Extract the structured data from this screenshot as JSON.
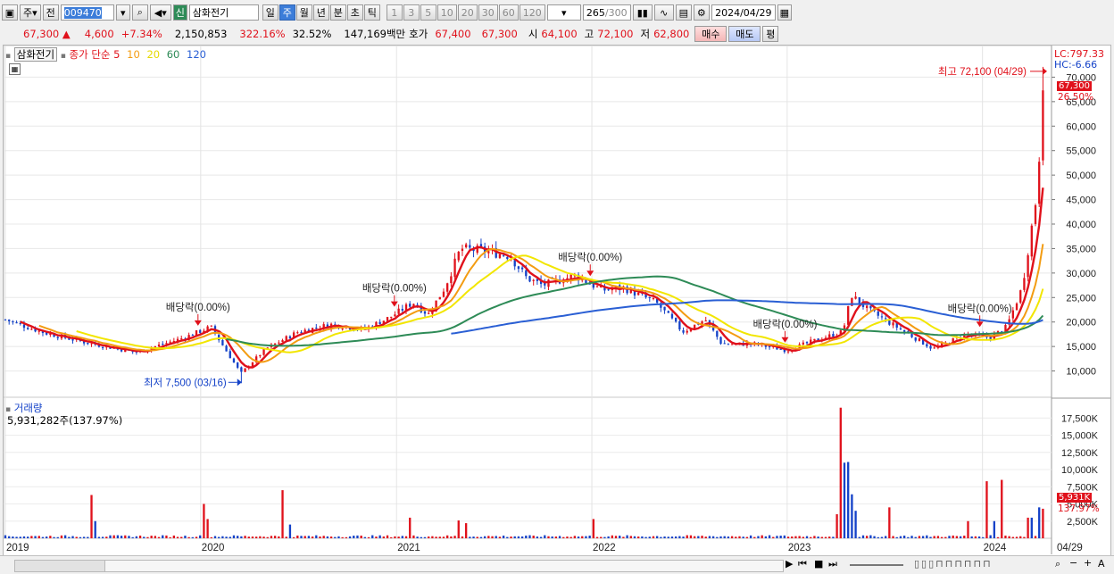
{
  "toolbar": {
    "period_type": "주",
    "prev_label": "전",
    "code": "009470",
    "credit_badge": "신",
    "stock_name": "삼화전기",
    "timeframes": [
      "일",
      "주",
      "월",
      "년",
      "분",
      "초",
      "틱"
    ],
    "selected_timeframe": "주",
    "intervals": [
      "1",
      "3",
      "5",
      "10",
      "20",
      "30",
      "60",
      "120"
    ],
    "count": "265",
    "count_total": "/300",
    "date": "2024/04/29"
  },
  "quote": {
    "price": "67,300 ▲",
    "change": "4,600",
    "change_pct": "+7.34%",
    "volume": "2,150,853",
    "volume_ratio": "322.16%",
    "turnover": "32.52%",
    "amount": "147,169백만",
    "hoga_label": "호가",
    "ask": "67,400",
    "bid": "67,300",
    "open_label": "시",
    "open": "64,100",
    "high_label": "고",
    "high": "72,100",
    "low_label": "저",
    "low": "62,800",
    "buy_label": "매수",
    "sell_label": "매도",
    "avg_label": "평"
  },
  "price_panel": {
    "name": "삼화전기",
    "legend_prefix": "종가 단순",
    "ma_periods": [
      "5",
      "10",
      "20",
      "60",
      "120"
    ],
    "lc": "LC:797.33",
    "hc": "HC:-6.66",
    "current_tag": "67,300",
    "pct_tag": "26.50%",
    "max_label": "최고 72,100 (04/29)",
    "min_label": "최저 7,500 (03/16)",
    "dividend_label": "배당락(0.00%)"
  },
  "volume_panel": {
    "title": "거래량",
    "value": "5,931,282주(137.97%)",
    "current_tag": "5,931K",
    "pct_tag": "137.97%"
  },
  "x_axis_end_label": "04/29",
  "colors": {
    "up": "#e0111b",
    "down": "#1442c8",
    "ma5": "#e0111b",
    "ma10": "#f39c12",
    "ma20": "#f2e600",
    "ma60": "#2e8b57",
    "ma120": "#2a5fd4"
  },
  "chart_data": [
    {
      "type": "candlestick",
      "title": "",
      "ylim": [
        5000,
        75000
      ],
      "yticks": [
        10000,
        15000,
        20000,
        25000,
        30000,
        35000,
        40000,
        45000,
        50000,
        55000,
        60000,
        65000,
        70000
      ],
      "x_labels": [
        "2019",
        "2020",
        "2021",
        "2022",
        "2023",
        "2024"
      ],
      "x_label_dates": [
        "2019-01-01",
        "2020-01-01",
        "2021-01-01",
        "2022-01-01",
        "2023-01-01",
        "2024-01-01"
      ],
      "date_range": [
        "2019-01-01",
        "2024-04-29"
      ],
      "close_trajectory": [
        [
          "2019-01-01",
          20500
        ],
        [
          "2019-03-15",
          17800
        ],
        [
          "2019-06-01",
          15800
        ],
        [
          "2019-09-01",
          13800
        ],
        [
          "2019-12-01",
          16800
        ],
        [
          "2020-01-20",
          19000
        ],
        [
          "2020-03-16",
          9500
        ],
        [
          "2020-05-01",
          14500
        ],
        [
          "2020-07-01",
          18000
        ],
        [
          "2020-09-01",
          19500
        ],
        [
          "2020-11-01",
          18500
        ],
        [
          "2020-12-20",
          21000
        ],
        [
          "2021-02-01",
          24000
        ],
        [
          "2021-03-01",
          21500
        ],
        [
          "2021-04-01",
          27000
        ],
        [
          "2021-05-01",
          35000
        ],
        [
          "2021-06-15",
          34500
        ],
        [
          "2021-08-01",
          33500
        ],
        [
          "2021-09-01",
          29000
        ],
        [
          "2021-10-01",
          27500
        ],
        [
          "2021-12-01",
          29500
        ],
        [
          "2022-01-20",
          26500
        ],
        [
          "2022-03-01",
          27000
        ],
        [
          "2022-05-01",
          24000
        ],
        [
          "2022-06-20",
          18000
        ],
        [
          "2022-08-01",
          20500
        ],
        [
          "2022-09-01",
          15500
        ],
        [
          "2022-11-01",
          15500
        ],
        [
          "2023-01-01",
          14200
        ],
        [
          "2023-03-01",
          16500
        ],
        [
          "2023-04-15",
          18000
        ],
        [
          "2023-05-01",
          25500
        ],
        [
          "2023-06-01",
          22500
        ],
        [
          "2023-08-01",
          18500
        ],
        [
          "2023-10-01",
          14500
        ],
        [
          "2023-12-01",
          17500
        ],
        [
          "2024-01-15",
          16800
        ],
        [
          "2024-02-15",
          19000
        ],
        [
          "2024-03-15",
          27000
        ],
        [
          "2024-04-10",
          45000
        ],
        [
          "2024-04-22",
          62700
        ],
        [
          "2024-04-29",
          67300
        ]
      ],
      "annotations": [
        {
          "text": "최고 72,100 (04/29)",
          "date": "2024-04-29",
          "value": 72100
        },
        {
          "text": "최저 7,500 (03/16)",
          "date": "2020-03-16",
          "value": 7500
        },
        {
          "text": "배당락(0.00%)",
          "date": "2019-12-27"
        },
        {
          "text": "배당락(0.00%)",
          "date": "2020-12-28"
        },
        {
          "text": "배당락(0.00%)",
          "date": "2021-12-29"
        },
        {
          "text": "배당락(0.00%)",
          "date": "2022-12-28"
        },
        {
          "text": "배당락(0.00%)",
          "date": "2023-12-27"
        }
      ],
      "series": [
        {
          "name": "5",
          "color": "#e0111b"
        },
        {
          "name": "10",
          "color": "#f39c12"
        },
        {
          "name": "20",
          "color": "#f2e600"
        },
        {
          "name": "60",
          "color": "#2e8b57"
        },
        {
          "name": "120",
          "color": "#2a5fd4"
        }
      ]
    },
    {
      "type": "bar",
      "title": "거래량",
      "ylim": [
        0,
        20000
      ],
      "yticks": [
        2500,
        5000,
        7500,
        10000,
        12500,
        15000,
        17500
      ],
      "ytick_labels": [
        "2,500K",
        "5,000K",
        "7,500K",
        "10,000K",
        "12,500K",
        "15,000K",
        "17,500K"
      ],
      "base_volume": 300,
      "spikes": [
        {
          "date": "2019-06-10",
          "value": 6300,
          "up": true
        },
        {
          "date": "2019-06-17",
          "value": 2500,
          "up": false
        },
        {
          "date": "2020-01-06",
          "value": 5000,
          "up": true
        },
        {
          "date": "2020-01-13",
          "value": 2800,
          "up": true
        },
        {
          "date": "2020-06-01",
          "value": 7000,
          "up": true
        },
        {
          "date": "2020-06-15",
          "value": 2000,
          "up": false
        },
        {
          "date": "2021-01-25",
          "value": 3000,
          "up": true
        },
        {
          "date": "2021-04-26",
          "value": 2600,
          "up": true
        },
        {
          "date": "2021-05-10",
          "value": 2200,
          "up": true
        },
        {
          "date": "2022-01-03",
          "value": 2800,
          "up": true
        },
        {
          "date": "2023-04-03",
          "value": 3500,
          "up": true
        },
        {
          "date": "2023-04-10",
          "value": 19000,
          "up": true
        },
        {
          "date": "2023-04-17",
          "value": 11000,
          "up": false
        },
        {
          "date": "2023-04-24",
          "value": 11100,
          "up": false
        },
        {
          "date": "2023-05-01",
          "value": 6400,
          "up": false
        },
        {
          "date": "2023-05-08",
          "value": 4000,
          "up": false
        },
        {
          "date": "2023-07-10",
          "value": 4500,
          "up": true
        },
        {
          "date": "2023-12-04",
          "value": 2500,
          "up": true
        },
        {
          "date": "2024-01-08",
          "value": 8300,
          "up": true
        },
        {
          "date": "2024-01-22",
          "value": 2500,
          "up": false
        },
        {
          "date": "2024-02-05",
          "value": 8500,
          "up": true
        },
        {
          "date": "2024-03-25",
          "value": 3000,
          "up": true
        },
        {
          "date": "2024-04-01",
          "value": 3000,
          "up": false
        },
        {
          "date": "2024-04-15",
          "value": 4500,
          "up": false
        },
        {
          "date": "2024-04-22",
          "value": 4300,
          "up": true
        },
        {
          "date": "2024-04-29",
          "value": 5931,
          "up": true
        }
      ]
    }
  ]
}
